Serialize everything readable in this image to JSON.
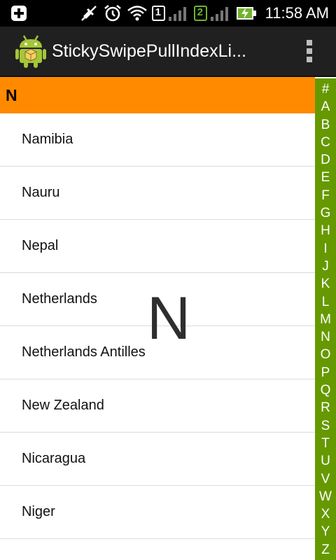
{
  "status_bar": {
    "time": "11:58 AM",
    "sim1_label": "1",
    "sim2_label": "2",
    "icons": [
      "usb-debug-icon",
      "mute-icon",
      "alarm-icon",
      "wifi-icon",
      "sim1-signal-icon",
      "sim2-signal-icon",
      "battery-charging-icon"
    ]
  },
  "action_bar": {
    "title": "StickySwipePullIndexLi...",
    "icon": "android-app-icon",
    "overflow_icon": "overflow-menu-icon"
  },
  "list": {
    "section_header": "N",
    "items": [
      "Namibia",
      "Nauru",
      "Nepal",
      "Netherlands",
      "Netherlands Antilles",
      "New Zealand",
      "Nicaragua",
      "Niger"
    ]
  },
  "overlay_letter": "N",
  "index_bar": {
    "letters": [
      "#",
      "A",
      "B",
      "C",
      "D",
      "E",
      "F",
      "G",
      "H",
      "I",
      "J",
      "K",
      "L",
      "M",
      "N",
      "O",
      "P",
      "Q",
      "R",
      "S",
      "T",
      "U",
      "V",
      "W",
      "X",
      "Y",
      "Z"
    ]
  },
  "colors": {
    "section_header_bg": "#ff8a00",
    "index_bar_bg": "#669900",
    "action_bar_bg": "#202020",
    "status_bar_bg": "#000000"
  }
}
